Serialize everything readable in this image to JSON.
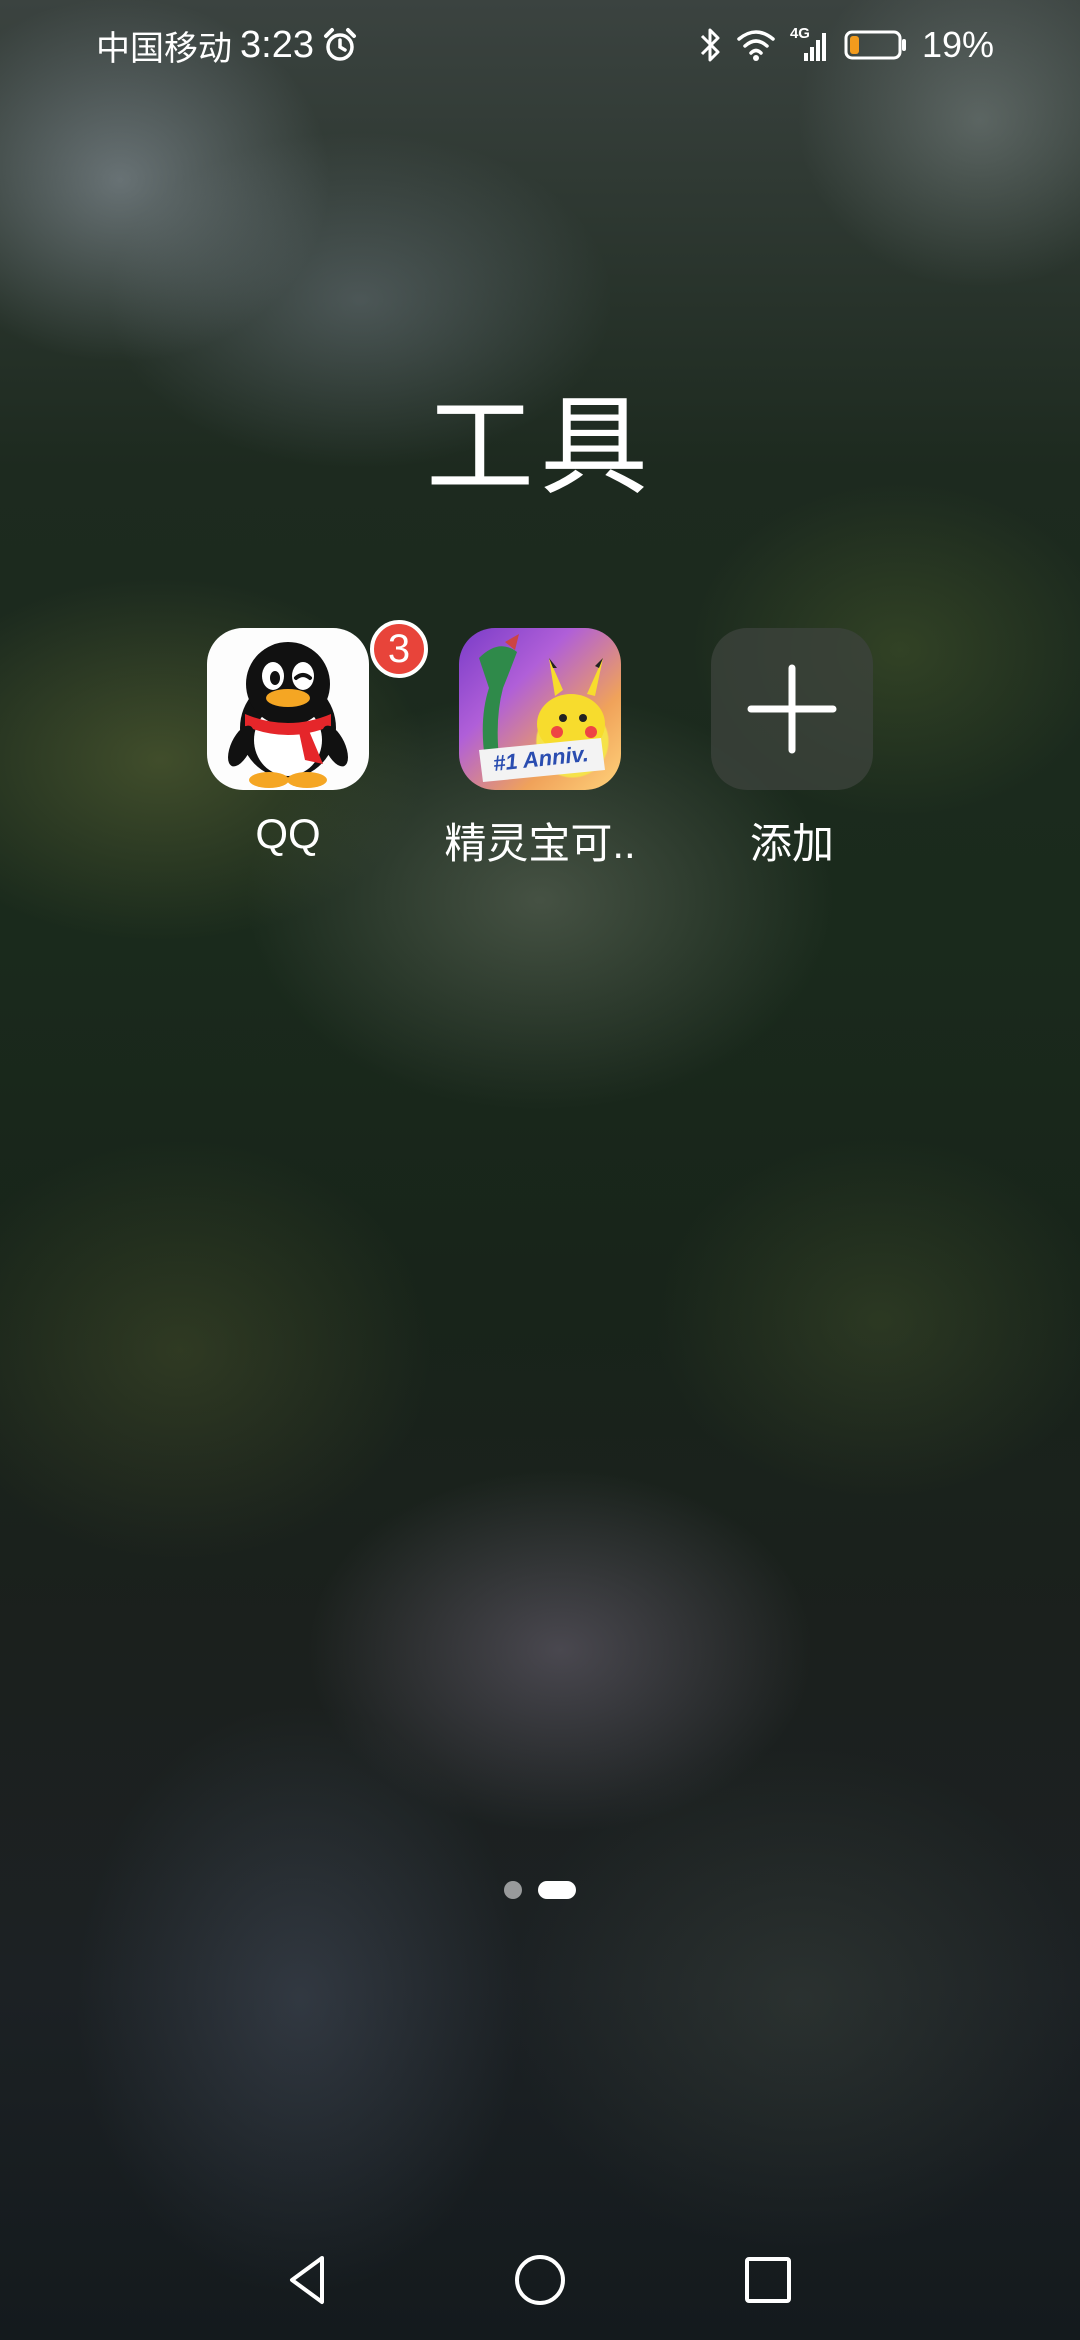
{
  "status_bar": {
    "carrier": "中国移动",
    "time": "3:23",
    "network_label": "4G",
    "battery_percent": "19%",
    "battery_level": 0.19,
    "icons": [
      "alarm-icon",
      "bluetooth-icon",
      "wifi-icon",
      "signal-icon",
      "battery-icon"
    ]
  },
  "folder": {
    "title": "工具",
    "apps": [
      {
        "label": "QQ",
        "icon": "qq-penguin-icon",
        "badge": "3"
      },
      {
        "label": "精灵宝可..",
        "icon": "pokemon-app-icon",
        "art_text": "#1 Anniv."
      },
      {
        "label": "添加",
        "icon": "plus-icon"
      }
    ]
  },
  "pagination": {
    "pages": 2,
    "active_page": 2
  },
  "navigation": {
    "icons": [
      "back-icon",
      "home-icon",
      "recent-apps-icon"
    ]
  },
  "colors": {
    "badge": "#e8443a",
    "battery_low": "#f29b1d",
    "qq_scarf": "#e5262a",
    "qq_beak": "#f5a623"
  }
}
